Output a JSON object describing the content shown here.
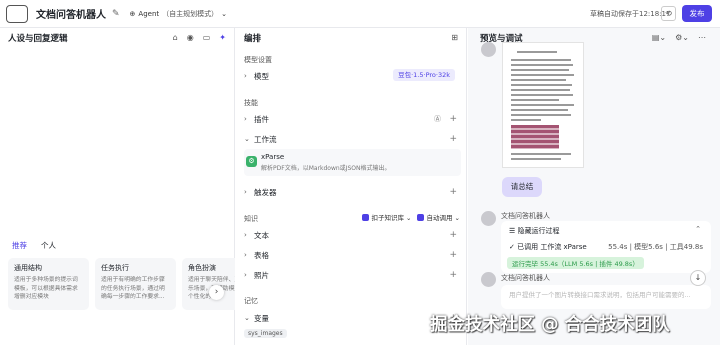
{
  "topbar": {
    "title": "文档问答机器人",
    "agent_label": "Agent",
    "agent_mode": "（自主规划模式）",
    "autosave": "草稿自动保存于12:18:17",
    "publish": "发布"
  },
  "left": {
    "heading": "人设与回复逻辑",
    "tabs": [
      "推荐",
      "个人"
    ],
    "cards": [
      {
        "title": "通用结构",
        "desc": "适用于多种场景的提示词模板，可以根据具体需求增删对应模块"
      },
      {
        "title": "任务执行",
        "desc": "适用于有明确的工作步骤的任务执行场景，通过明确每一步骤的工作要求..."
      },
      {
        "title": "角色扮演",
        "desc": "适用于聊天陪伴、互动娱乐场景，可帮助模型塑造个性化的..."
      }
    ]
  },
  "mid": {
    "heading": "编排",
    "model_section": "模型设置",
    "model_label": "模型",
    "model_value": "豆包·1.5·Pro·32k",
    "skills_section": "技能",
    "plugin_label": "插件",
    "workflow_label": "工作流",
    "xparse_name": "xParse",
    "xparse_desc": "解析PDF文档，以Markdown或JSON格式输出。",
    "trigger_label": "触发器",
    "knowledge_section": "知识",
    "kb_chip1": "扣子知识库",
    "kb_chip2": "自动调用",
    "text_label": "文本",
    "table_label": "表格",
    "photo_label": "照片",
    "memory_section": "记忆",
    "var_label": "变量",
    "var_tag": "sys_images"
  },
  "right": {
    "heading": "预览与调试",
    "user_msg": "请总结",
    "bot_name": "文档问答机器人",
    "hide_process": "隐藏运行过程",
    "called_workflow": "已调用 工作流 xParse",
    "call_stats": "55.4s | 模型5.6s | 工具49.8s",
    "done_badge": "运行完毕 55.4s（LLM 5.6s | 插件 49.8s）",
    "bot_name2": "文档问答机器人",
    "reply_text": "用户提供了一个图片转换接口需求说明，包括用户可能需要的..."
  },
  "watermark": "掘金技术社区 @ 合合技术团队"
}
